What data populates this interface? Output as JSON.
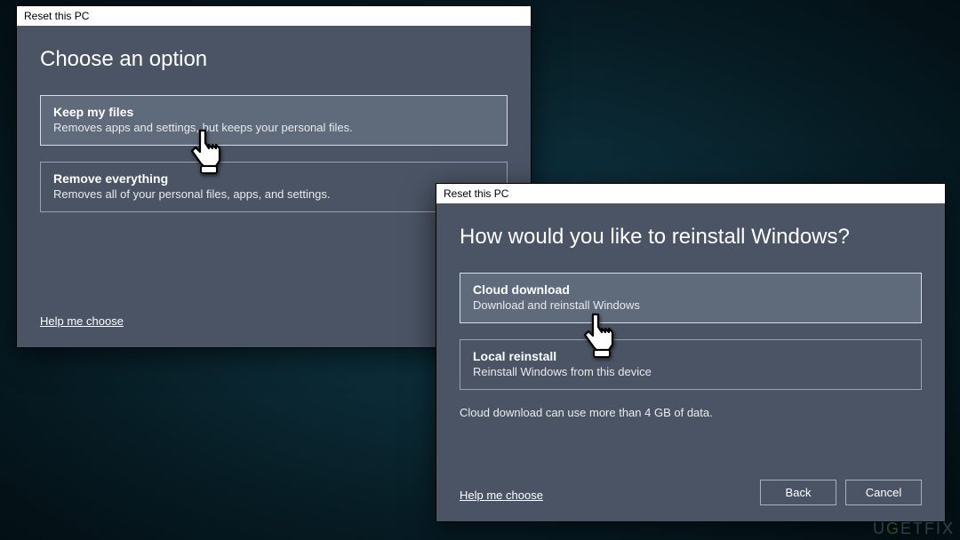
{
  "dialog1": {
    "title": "Reset this PC",
    "heading": "Choose an option",
    "options": [
      {
        "title": "Keep my files",
        "desc": "Removes apps and settings, but keeps your personal files."
      },
      {
        "title": "Remove everything",
        "desc": "Removes all of your personal files, apps, and settings."
      }
    ],
    "help": "Help me choose"
  },
  "dialog2": {
    "title": "Reset this PC",
    "heading": "How would you like to reinstall Windows?",
    "options": [
      {
        "title": "Cloud download",
        "desc": "Download and reinstall Windows"
      },
      {
        "title": "Local reinstall",
        "desc": "Reinstall Windows from this device"
      }
    ],
    "note": "Cloud download can use more than 4 GB of data.",
    "help": "Help me choose",
    "buttons": {
      "back": "Back",
      "cancel": "Cancel"
    }
  },
  "watermark": "UGETFIX"
}
